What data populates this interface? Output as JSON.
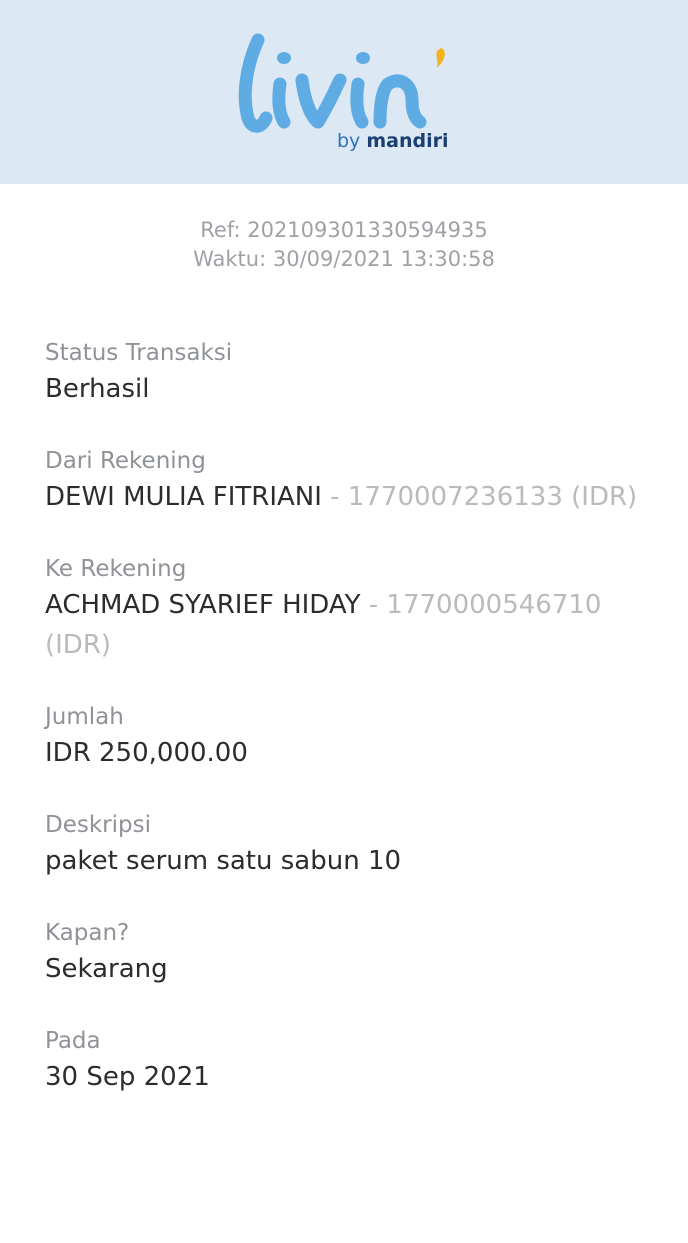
{
  "brand": {
    "logo_text": "livin'",
    "by": "by",
    "name": "mandiri",
    "colors": {
      "logo": "#5fabe3",
      "accent": "#f6b21b",
      "header_bg": "#dce8f4"
    }
  },
  "receipt": {
    "ref_label": "Ref: 202109301330594935",
    "time_label": "Waktu: 30/09/2021 13:30:58"
  },
  "fields": {
    "status": {
      "label": "Status Transaksi",
      "value": "Berhasil"
    },
    "from": {
      "label": "Dari Rekening",
      "name": "DEWI MULIA FITRIANI",
      "account": " - 1770007236133 (IDR)"
    },
    "to": {
      "label": "Ke Rekening",
      "name": "ACHMAD SYARIEF HIDAY",
      "account": " - 1770000546710 (IDR)"
    },
    "amount": {
      "label": "Jumlah",
      "value": "IDR 250,000.00"
    },
    "description": {
      "label": "Deskripsi",
      "value": "paket serum satu sabun 10"
    },
    "when": {
      "label": "Kapan?",
      "value": "Sekarang"
    },
    "date": {
      "label": "Pada",
      "value": "30 Sep 2021"
    }
  }
}
